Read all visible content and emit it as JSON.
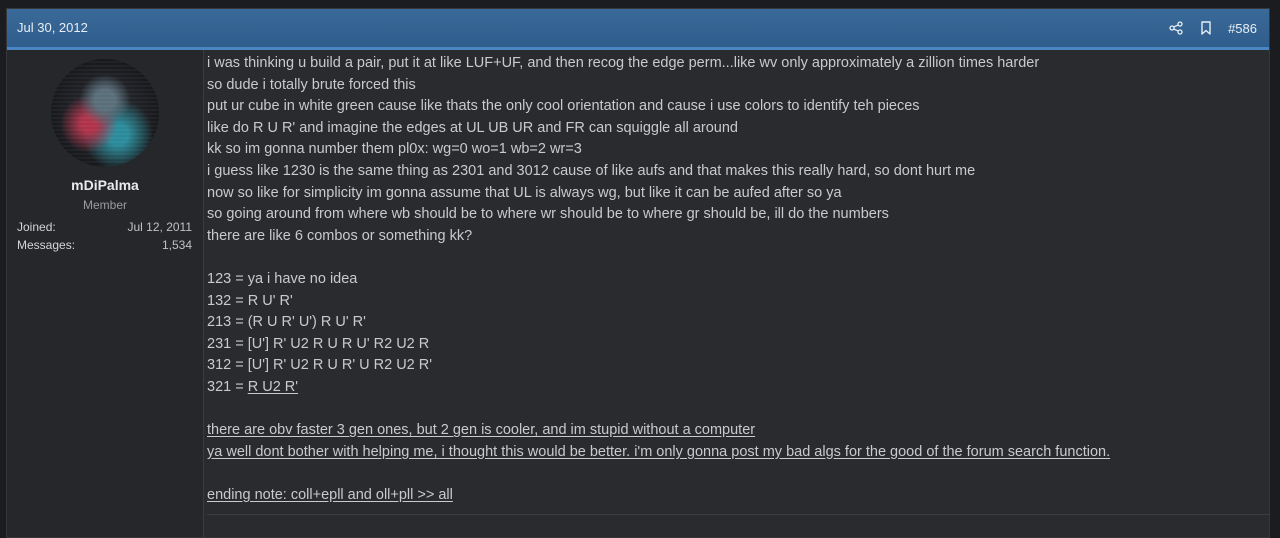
{
  "post": {
    "date": "Jul 30, 2012",
    "number": "#586",
    "share_icon": "share-icon",
    "bookmark_icon": "bookmark-icon"
  },
  "user": {
    "name": "mDiPalma",
    "title": "Member",
    "joined_label": "Joined:",
    "joined_value": "Jul 12, 2011",
    "messages_label": "Messages:",
    "messages_value": "1,534"
  },
  "body": {
    "lines": [
      "i was thinking u build a pair, put it at like LUF+UF, and then recog the edge perm...like wv only approximately a zillion times harder",
      "so dude i totally brute forced this",
      "put ur cube in white green cause like thats the only cool orientation and cause i use colors to identify teh pieces",
      "like do R U R' and imagine the edges at UL UB UR and FR can squiggle all around",
      "kk so im gonna number them pl0x: wg=0 wo=1 wb=2 wr=3",
      "i guess like 1230 is the same thing as 2301 and 3012 cause of like aufs and that makes this really hard, so dont hurt me",
      "now so like for simplicity im gonna assume that UL is always wg, but like it can be aufed after so ya",
      "so going around from where wb should be to where wr should be to where gr should be, ill do the numbers",
      "there are like 6 combos or something kk?"
    ],
    "algs": [
      "123 = ya i have no idea",
      "132 = R U' R'",
      "213 = (R U R' U') R U' R'",
      "231 = [U'] R' U2 R U R U' R2 U2 R",
      "312 = [U'] R' U2 R U R' U R2 U2 R'"
    ],
    "alg_321_prefix": "321 = ",
    "alg_321_link": "R U2 R'",
    "notes": [
      "there are obv faster 3 gen ones, but 2 gen is cooler, and im stupid without a computer",
      "ya well dont bother with helping me, i thought this would be better. i'm only gonna post my bad algs for the good of the forum search function."
    ],
    "ending": "ending note: coll+epll and oll+pll >> all"
  }
}
